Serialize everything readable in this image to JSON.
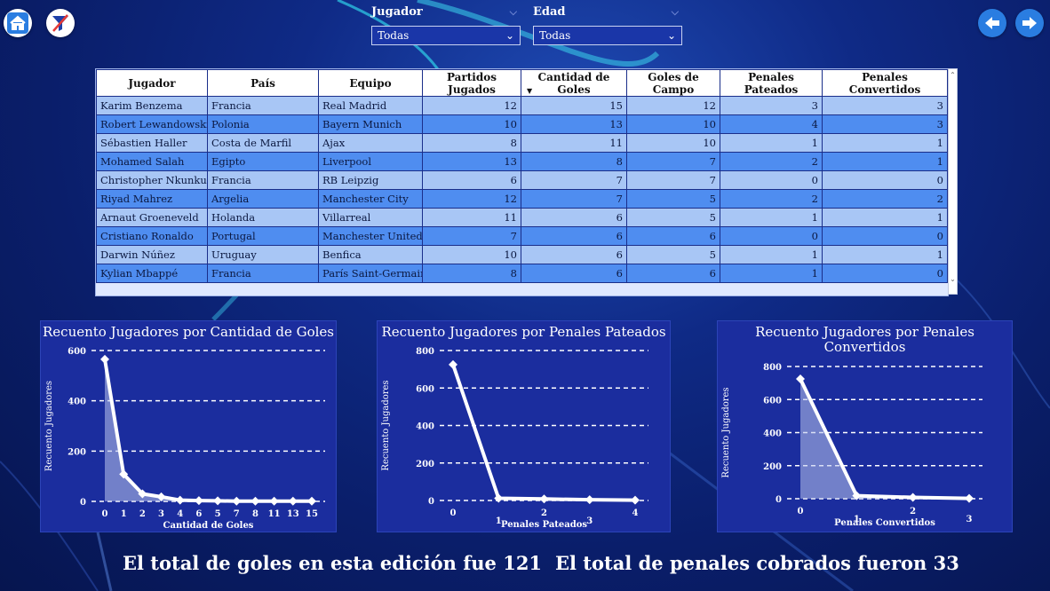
{
  "nav": {
    "home_icon": "home-icon",
    "filter_icon": "filter-clear-icon",
    "back_icon": "arrow-left-icon",
    "forward_icon": "arrow-right-icon"
  },
  "slicers": [
    {
      "title": "Jugador",
      "value": "Todas"
    },
    {
      "title": "Edad",
      "value": "Todas"
    }
  ],
  "table": {
    "columns": [
      "Jugador",
      "País",
      "Equipo",
      "Partidos Jugados",
      "Cantidad de Goles",
      "Goles de Campo",
      "Penales Pateados",
      "Penales Convertidos"
    ],
    "rows": [
      [
        "Karim Benzema",
        "Francia",
        "Real Madrid",
        "12",
        "15",
        "12",
        "3",
        "3"
      ],
      [
        "Robert Lewandowski",
        "Polonia",
        "Bayern Munich",
        "10",
        "13",
        "10",
        "4",
        "3"
      ],
      [
        "Sébastien Haller",
        "Costa de Marfil",
        "Ajax",
        "8",
        "11",
        "10",
        "1",
        "1"
      ],
      [
        "Mohamed Salah",
        "Egipto",
        "Liverpool",
        "13",
        "8",
        "7",
        "2",
        "1"
      ],
      [
        "Christopher Nkunku",
        "Francia",
        "RB Leipzig",
        "6",
        "7",
        "7",
        "0",
        "0"
      ],
      [
        "Riyad Mahrez",
        "Argelia",
        "Manchester City",
        "12",
        "7",
        "5",
        "2",
        "2"
      ],
      [
        "Arnaut Groeneveld",
        "Holanda",
        "Villarreal",
        "11",
        "6",
        "5",
        "1",
        "1"
      ],
      [
        "Cristiano Ronaldo",
        "Portugal",
        "Manchester United",
        "7",
        "6",
        "6",
        "0",
        "0"
      ],
      [
        "Darwin Núñez",
        "Uruguay",
        "Benfica",
        "10",
        "6",
        "5",
        "1",
        "1"
      ],
      [
        "Kylian Mbappé",
        "Francia",
        "París Saint-Germain",
        "8",
        "6",
        "6",
        "1",
        "0"
      ]
    ]
  },
  "chart_data": [
    {
      "type": "area",
      "title": "Recuento Jugadores por Cantidad de Goles",
      "xlabel": "Cantidad de Goles",
      "ylabel": "Recuento Jugadores",
      "categories": [
        "0",
        "1",
        "2",
        "3",
        "4",
        "6",
        "5",
        "7",
        "8",
        "11",
        "13",
        "15"
      ],
      "values": [
        565,
        108,
        30,
        18,
        5,
        3,
        2,
        1,
        1,
        1,
        1,
        1
      ],
      "yticks": [
        0,
        200,
        400,
        600
      ],
      "ylim": [
        0,
        600
      ],
      "grid": true
    },
    {
      "type": "line",
      "title": "Recuento Jugadores por Penales Pateados",
      "xlabel": "Penales Pateados",
      "ylabel": "Recuento Jugadores",
      "categories": [
        "0",
        "1",
        "2",
        "3",
        "4"
      ],
      "values": [
        725,
        12,
        8,
        4,
        2
      ],
      "yticks": [
        0,
        200,
        400,
        600,
        800
      ],
      "ylim": [
        0,
        800
      ],
      "grid": true
    },
    {
      "type": "area",
      "title": "Recuento Jugadores por Penales Convertidos",
      "title_lines": [
        "Recuento Jugadores por Penales",
        "Convertidos"
      ],
      "xlabel": "Penales Convertidos",
      "ylabel": "Recuento Jugadores",
      "categories": [
        "0",
        "1",
        "2",
        "3"
      ],
      "values": [
        725,
        18,
        8,
        2
      ],
      "yticks": [
        0,
        200,
        400,
        600,
        800
      ],
      "ylim": [
        0,
        800
      ],
      "grid": true
    }
  ],
  "footer": {
    "goals_text": "El total de goles en esta edición fue 121",
    "penalties_text": "El total de penales cobrados fueron 33"
  }
}
